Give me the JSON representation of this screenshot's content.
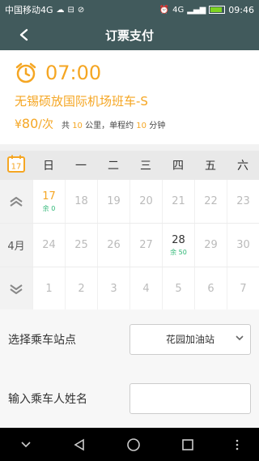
{
  "status_bar": {
    "carrier": "中国移动4G",
    "network": "4G",
    "time": "09:46"
  },
  "header": {
    "title": "订票支付"
  },
  "trip": {
    "departure_time": "07:00",
    "route_name": "无锡硕放国际机场班车-S",
    "currency_symbol": "¥",
    "price": "80",
    "price_unit": "/次",
    "distance_prefix": "共",
    "distance_value": "10",
    "distance_unit": "公里，单程约",
    "duration_value": "10",
    "duration_unit": "分钟"
  },
  "calendar": {
    "icon_day": "17",
    "weekdays": [
      "日",
      "一",
      "二",
      "三",
      "四",
      "五",
      "六"
    ],
    "month_label": "4月",
    "rows": [
      [
        {
          "num": "17",
          "remain": "余 0",
          "state": "today"
        },
        {
          "num": "18",
          "remain": "",
          "state": ""
        },
        {
          "num": "19",
          "remain": "",
          "state": ""
        },
        {
          "num": "20",
          "remain": "",
          "state": ""
        },
        {
          "num": "21",
          "remain": "",
          "state": ""
        },
        {
          "num": "22",
          "remain": "",
          "state": ""
        },
        {
          "num": "23",
          "remain": "",
          "state": ""
        }
      ],
      [
        {
          "num": "24",
          "remain": "",
          "state": ""
        },
        {
          "num": "25",
          "remain": "",
          "state": ""
        },
        {
          "num": "26",
          "remain": "",
          "state": ""
        },
        {
          "num": "27",
          "remain": "",
          "state": ""
        },
        {
          "num": "28",
          "remain": "余 50",
          "state": "avail"
        },
        {
          "num": "29",
          "remain": "",
          "state": ""
        },
        {
          "num": "30",
          "remain": "",
          "state": ""
        }
      ],
      [
        {
          "num": "1",
          "remain": "",
          "state": ""
        },
        {
          "num": "2",
          "remain": "",
          "state": ""
        },
        {
          "num": "3",
          "remain": "",
          "state": ""
        },
        {
          "num": "4",
          "remain": "",
          "state": ""
        },
        {
          "num": "5",
          "remain": "",
          "state": ""
        },
        {
          "num": "6",
          "remain": "",
          "state": ""
        },
        {
          "num": "7",
          "remain": "",
          "state": ""
        }
      ]
    ]
  },
  "form": {
    "station_label": "选择乘车站点",
    "station_value": "花园加油站",
    "name_label": "输入乘车人姓名",
    "name_value": ""
  },
  "colors": {
    "header_bg": "#415a5c",
    "accent": "#f5a623",
    "remain_green": "#2bb673"
  }
}
